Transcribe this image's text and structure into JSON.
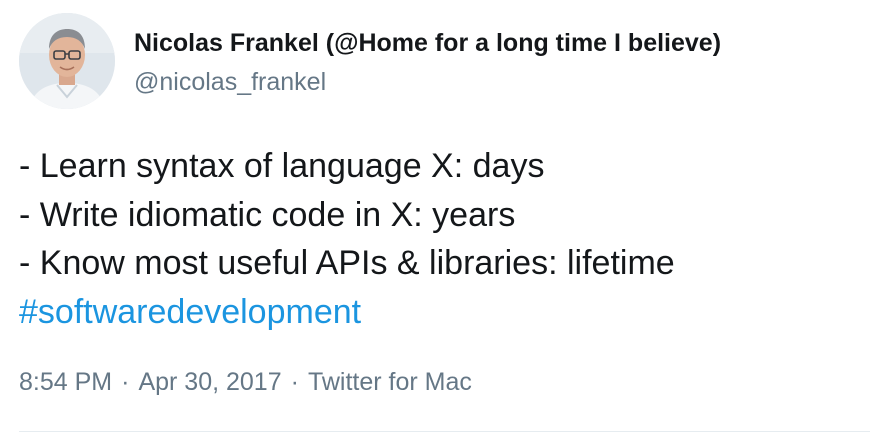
{
  "author": {
    "display_name": "Nicolas Frankel (@Home for a long time I believe)",
    "handle": "@nicolas_frankel",
    "avatar_icon": "user-avatar-photo"
  },
  "tweet": {
    "lines": [
      "- Learn syntax of language X: days",
      "- Write idiomatic code in X: years",
      "- Know most useful APIs & libraries: lifetime"
    ],
    "hashtag": "#softwaredevelopment"
  },
  "meta": {
    "time": "8:54 PM",
    "date": "Apr 30, 2017",
    "source": "Twitter for Mac",
    "separator": "·"
  },
  "colors": {
    "text": "#14171a",
    "secondary": "#657786",
    "link": "#1b95e0",
    "divider": "#e6ecf0"
  }
}
